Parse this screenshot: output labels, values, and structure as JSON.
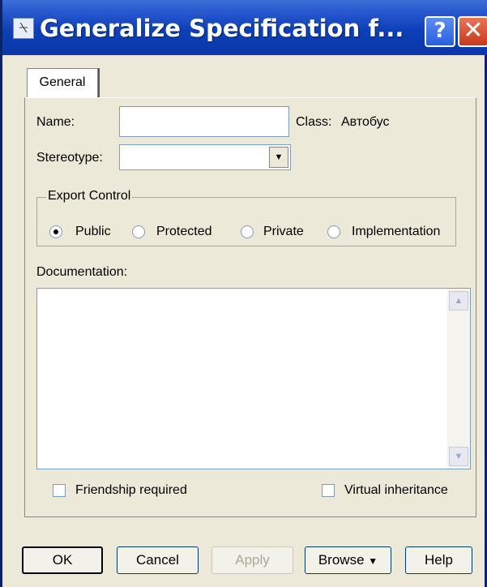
{
  "window": {
    "title": "Generalize Specification f...",
    "help_glyph": "?",
    "close_glyph": "✕"
  },
  "tabs": [
    {
      "label": "General",
      "active": true
    }
  ],
  "fields": {
    "name_label": "Name:",
    "name_value": "",
    "class_label": "Class:",
    "class_value": "Автобус",
    "stereotype_label": "Stereotype:",
    "stereotype_value": ""
  },
  "export_control": {
    "legend": "Export Control",
    "options": [
      {
        "label": "Public",
        "checked": true
      },
      {
        "label": "Protected",
        "checked": false
      },
      {
        "label": "Private",
        "checked": false
      },
      {
        "label": "Implementation",
        "checked": false
      }
    ]
  },
  "documentation": {
    "label": "Documentation:",
    "value": ""
  },
  "checkboxes": {
    "friendship": {
      "label": "Friendship required",
      "checked": false
    },
    "virtual": {
      "label": "Virtual inheritance",
      "checked": false
    }
  },
  "buttons": {
    "ok": "OK",
    "cancel": "Cancel",
    "apply": "Apply",
    "browse": "Browse",
    "browse_arrow": "▼",
    "help": "Help"
  },
  "icons": {
    "title_icon": "specification-icon",
    "combo_arrow": "▼",
    "scroll_up": "▲",
    "scroll_down": "▼"
  }
}
